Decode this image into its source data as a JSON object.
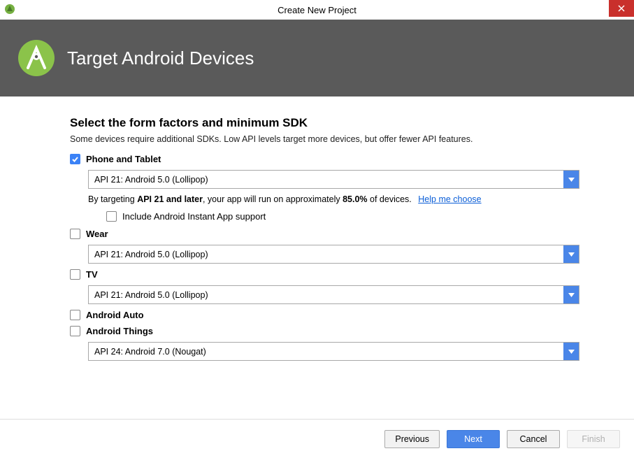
{
  "window": {
    "title": "Create New Project"
  },
  "header": {
    "title": "Target Android Devices"
  },
  "section": {
    "title": "Select the form factors and minimum SDK",
    "subtitle": "Some devices require additional SDKs. Low API levels target more devices, but offer fewer API features."
  },
  "formFactors": {
    "phone": {
      "label": "Phone and Tablet",
      "checked": true,
      "sdk": "API 21: Android 5.0 (Lollipop)",
      "note_prefix": "By targeting ",
      "note_bold1": "API 21 and later",
      "note_mid": ", your app will run on approximately ",
      "note_bold2": "85.0%",
      "note_suffix": " of devices.",
      "help_link": "Help me choose",
      "instant_label": "Include Android Instant App support",
      "instant_checked": false
    },
    "wear": {
      "label": "Wear",
      "checked": false,
      "sdk": "API 21: Android 5.0 (Lollipop)"
    },
    "tv": {
      "label": "TV",
      "checked": false,
      "sdk": "API 21: Android 5.0 (Lollipop)"
    },
    "auto": {
      "label": "Android Auto",
      "checked": false
    },
    "things": {
      "label": "Android Things",
      "checked": false,
      "sdk": "API 24: Android 7.0 (Nougat)"
    }
  },
  "buttons": {
    "previous": "Previous",
    "next": "Next",
    "cancel": "Cancel",
    "finish": "Finish"
  }
}
